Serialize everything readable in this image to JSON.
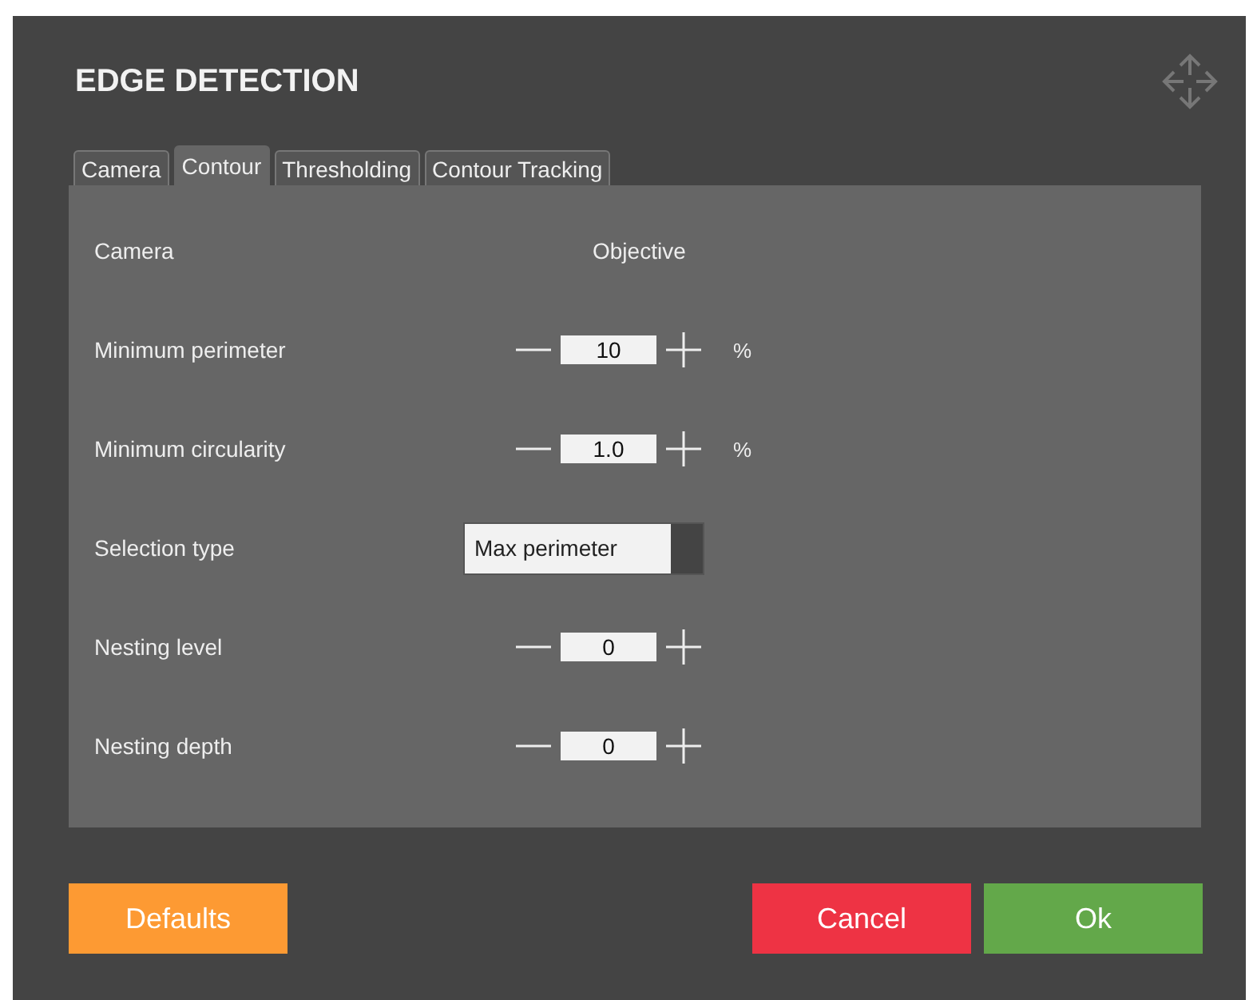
{
  "window": {
    "title": "EDGE DETECTION"
  },
  "tabs": [
    {
      "label": "Camera",
      "selected": false
    },
    {
      "label": "Contour",
      "selected": true
    },
    {
      "label": "Thresholding",
      "selected": false
    },
    {
      "label": "Contour Tracking",
      "selected": false
    }
  ],
  "rows": [
    {
      "kind": "info",
      "label": "Camera",
      "value": "Objective"
    },
    {
      "kind": "stepper",
      "label": "Minimum perimeter",
      "value": "10",
      "unit": "%"
    },
    {
      "kind": "stepper",
      "label": "Minimum circularity",
      "value": "1.0",
      "unit": "%"
    },
    {
      "kind": "select",
      "label": "Selection type",
      "value": "Max perimeter"
    },
    {
      "kind": "stepper",
      "label": "Nesting level",
      "value": "0"
    },
    {
      "kind": "stepper",
      "label": "Nesting depth",
      "value": "0"
    }
  ],
  "buttons": [
    {
      "label": "Defaults",
      "kind": "defaults"
    },
    {
      "label": "Cancel",
      "kind": "cancel"
    },
    {
      "label": "Ok",
      "kind": "ok"
    }
  ]
}
